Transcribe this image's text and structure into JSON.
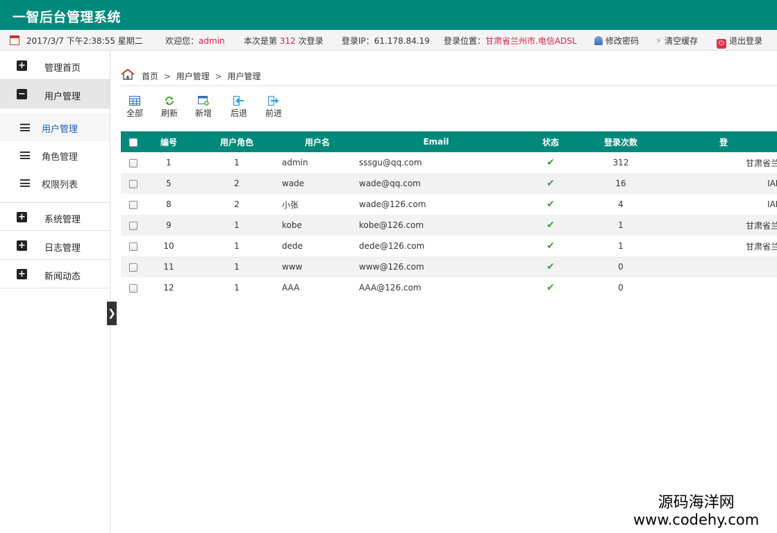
{
  "app": {
    "title": "一智后台管理系统"
  },
  "infobar": {
    "datetime": "2017/3/7 下午2:38:55 星期二",
    "welcome_label": "欢迎您：",
    "username": "admin",
    "login_count_prefix": "本次是第",
    "login_count": "312",
    "login_count_suffix": "次登录",
    "ip": "登录IP：61.178.84.19",
    "location_label": "登录位置：",
    "location": "甘肃省兰州市.电信ADSL",
    "change_password": "修改密码",
    "clear_cache": "清空缓存",
    "logout": "退出登录"
  },
  "sidebar": {
    "groups": [
      {
        "label": "管理首页",
        "symbol": "+"
      },
      {
        "label": "用户管理",
        "symbol": "−"
      },
      {
        "label": "系统管理",
        "symbol": "+"
      },
      {
        "label": "日志管理",
        "symbol": "+"
      },
      {
        "label": "新闻动态",
        "symbol": "+"
      }
    ],
    "sub_items": [
      {
        "label": "用户管理"
      },
      {
        "label": "角色管理"
      },
      {
        "label": "权限列表"
      }
    ],
    "collapse_glyph": "❯"
  },
  "breadcrumb": {
    "items": [
      "首页",
      "用户管理",
      "用户管理"
    ],
    "separator": ">"
  },
  "toolbar": {
    "all": "全部",
    "refresh": "刷新",
    "add": "新增",
    "back": "后退",
    "forward": "前进"
  },
  "table": {
    "headers": [
      "编号",
      "用户角色",
      "用户名",
      "Email",
      "状态",
      "登录次数",
      "登"
    ],
    "rows": [
      {
        "id": "1",
        "role": "1",
        "username": "admin",
        "email": "sssgu@qq.com",
        "logins": "312",
        "location": "甘肃省兰州"
      },
      {
        "id": "5",
        "role": "2",
        "username": "wade",
        "email": "wade@qq.com",
        "logins": "16",
        "location": "IANA"
      },
      {
        "id": "8",
        "role": "2",
        "username": "小张",
        "email": "wade@126.com",
        "logins": "4",
        "location": "IANA"
      },
      {
        "id": "9",
        "role": "1",
        "username": "kobe",
        "email": "kobe@126.com",
        "logins": "1",
        "location": "甘肃省兰州"
      },
      {
        "id": "10",
        "role": "1",
        "username": "dede",
        "email": "dede@126.com",
        "logins": "1",
        "location": "甘肃省兰州"
      },
      {
        "id": "11",
        "role": "1",
        "username": "www",
        "email": "www@126.com",
        "logins": "0",
        "location": ""
      },
      {
        "id": "12",
        "role": "1",
        "username": "AAA",
        "email": "AAA@126.com",
        "logins": "0",
        "location": ""
      }
    ],
    "status_glyph": "✔"
  },
  "watermark": {
    "name": "源码海洋网",
    "url": "www.codehy.com"
  },
  "colors": {
    "brand": "#00897b",
    "accent_red": "#d9204c",
    "active_link": "#1a5fb4",
    "check_green": "#3aa03a"
  }
}
